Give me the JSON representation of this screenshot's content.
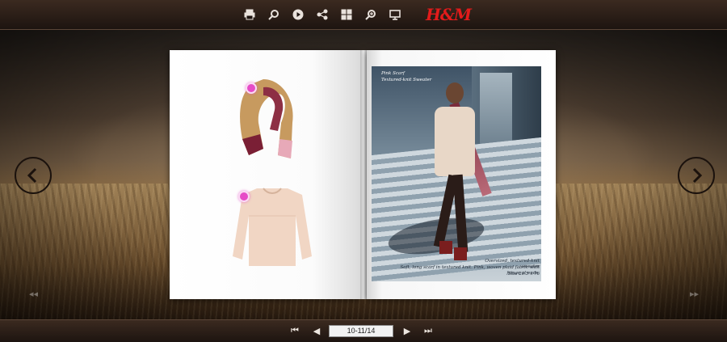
{
  "app": {
    "brand_label": "H&M"
  },
  "toolbar": {
    "buttons": [
      {
        "name": "print",
        "icon": "print-icon"
      },
      {
        "name": "search",
        "icon": "search-icon"
      },
      {
        "name": "autoplay",
        "icon": "play-icon"
      },
      {
        "name": "share",
        "icon": "share-icon"
      },
      {
        "name": "thumbnails",
        "icon": "grid-icon"
      },
      {
        "name": "zoom",
        "icon": "zoom-icon"
      },
      {
        "name": "fullscreen",
        "icon": "monitor-icon"
      }
    ]
  },
  "page": {
    "navigation": {
      "left_icon": "chevron-left-icon",
      "right_icon": "chevron-right-icon"
    },
    "right_photo": {
      "caption_title": "Pink Scarf",
      "caption_subtitle": "Textured-knit Sweater",
      "caption_bottom_1": "Oversized, textured-knit sweater",
      "caption_bottom_2": "Soft, long scarf in textured knit. Pink, woven plaid fabric with fringe at ends.",
      "caption_bottom_3": "Size 29.5 x 76"
    }
  },
  "bottombar": {
    "first_label": "⏮",
    "prev_label": "◀",
    "next_label": "▶",
    "last_label": "⏭",
    "page_indicator": "10-11/14"
  },
  "colors": {
    "accent": "#e21b1b",
    "hotspot": "#e64cc7",
    "bar_bg": "#2b1e17"
  }
}
